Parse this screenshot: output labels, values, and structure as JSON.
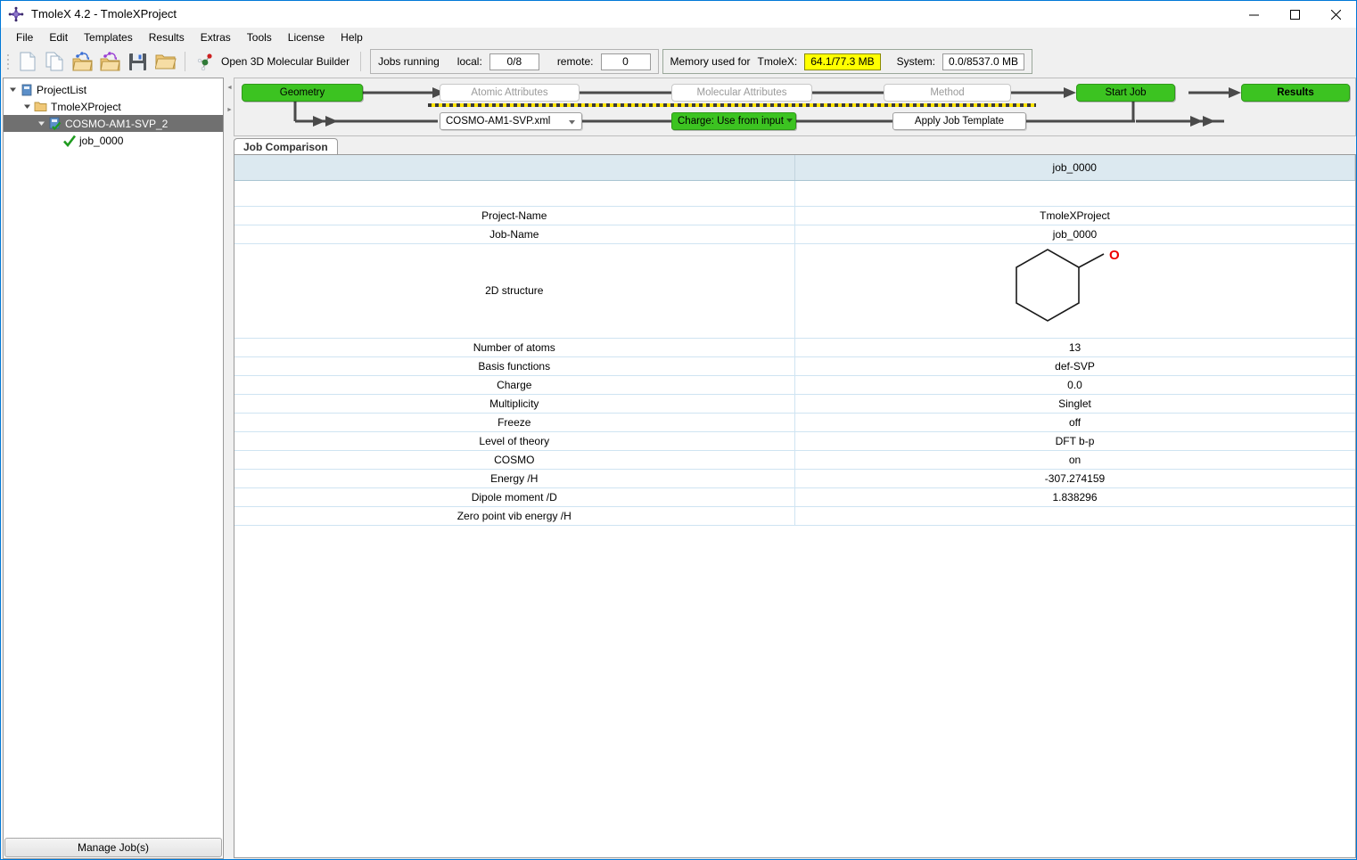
{
  "window": {
    "title": "TmoleX 4.2 - TmoleXProject",
    "app_icon": "tmolex-logo-icon",
    "controls": {
      "minimize": "minimize-icon",
      "maximize": "maximize-icon",
      "close": "close-icon"
    }
  },
  "menu": [
    "File",
    "Edit",
    "Templates",
    "Results",
    "Extras",
    "Tools",
    "License",
    "Help"
  ],
  "toolbar": {
    "icons": [
      {
        "name": "new-document-icon"
      },
      {
        "name": "copy-document-icon"
      },
      {
        "name": "open-molecule-folder-icon"
      },
      {
        "name": "open-molecule-folder-alt-icon"
      },
      {
        "name": "save-icon"
      },
      {
        "name": "open-folder-icon"
      }
    ],
    "builder_label": "Open 3D Molecular Builder",
    "builder_icon": "molecule-icon"
  },
  "status": {
    "jobs_label": "Jobs running",
    "local_label": "local:",
    "local_value": "0/8",
    "remote_label": "remote:",
    "remote_value": "0",
    "memory_label": "Memory used for",
    "tmolex_label": "TmoleX:",
    "tmolex_value": "64.1/77.3 MB",
    "tmolex_value_color": "#ffff00",
    "system_label": "System:",
    "system_value": "0.0/8537.0 MB"
  },
  "workflow": {
    "accent_green": "#3cc321",
    "steps": [
      {
        "label": "Geometry",
        "state": "active"
      },
      {
        "label": "Atomic Attributes",
        "state": "disabled"
      },
      {
        "label": "Molecular Attributes",
        "state": "disabled"
      },
      {
        "label": "Method",
        "state": "disabled"
      },
      {
        "label": "Start Job",
        "state": "active"
      },
      {
        "label": "Results",
        "state": "active"
      }
    ],
    "template_select_value": "COSMO-AM1-SVP.xml",
    "charge_label": "Charge:  Use from input",
    "apply_template_label": "Apply Job Template"
  },
  "sidebar": {
    "tree": [
      {
        "label": "ProjectList",
        "indent": 0,
        "icon": "project-list-icon",
        "twisty": "down",
        "selected": false,
        "check": false
      },
      {
        "label": "TmoleXProject",
        "indent": 1,
        "icon": "folder-icon",
        "twisty": "down",
        "selected": false,
        "check": false
      },
      {
        "label": "COSMO-AM1-SVP_2",
        "indent": 2,
        "icon": "project-icon",
        "twisty": "down",
        "selected": true,
        "check": false
      },
      {
        "label": "job_0000",
        "indent": 3,
        "icon": "check-icon",
        "twisty": "none",
        "selected": false,
        "check": true
      }
    ],
    "manage_jobs_label": "Manage Job(s)"
  },
  "main": {
    "tab_label": "Job Comparison",
    "table": {
      "headers": [
        "",
        "job_0000"
      ],
      "rows": [
        {
          "label": "",
          "value": "",
          "kind": "spacer"
        },
        {
          "label": "Project-Name",
          "value": "TmoleXProject",
          "kind": "text"
        },
        {
          "label": "Job-Name",
          "value": "job_0000",
          "kind": "text"
        },
        {
          "label": "2D structure",
          "value": "",
          "kind": "structure"
        },
        {
          "label": "Number of atoms",
          "value": "13",
          "kind": "text"
        },
        {
          "label": "Basis functions",
          "value": "def-SVP",
          "kind": "text"
        },
        {
          "label": "Charge",
          "value": "0.0",
          "kind": "text"
        },
        {
          "label": "Multiplicity",
          "value": "Singlet",
          "kind": "text"
        },
        {
          "label": "Freeze",
          "value": "off",
          "kind": "text"
        },
        {
          "label": "Level of theory",
          "value": "DFT b-p",
          "kind": "text"
        },
        {
          "label": "COSMO",
          "value": "on",
          "kind": "text"
        },
        {
          "label": "Energy /H",
          "value": "-307.274159",
          "kind": "text"
        },
        {
          "label": "Dipole moment /D",
          "value": "1.838296",
          "kind": "text"
        },
        {
          "label": "Zero point vib energy /H",
          "value": "",
          "kind": "text"
        }
      ]
    },
    "structure": {
      "name": "cyclohexanol-2d-structure",
      "heteroatom_label": "O",
      "heteroatom_color": "#ee0000",
      "bond_color": "#1a1a1a"
    }
  }
}
